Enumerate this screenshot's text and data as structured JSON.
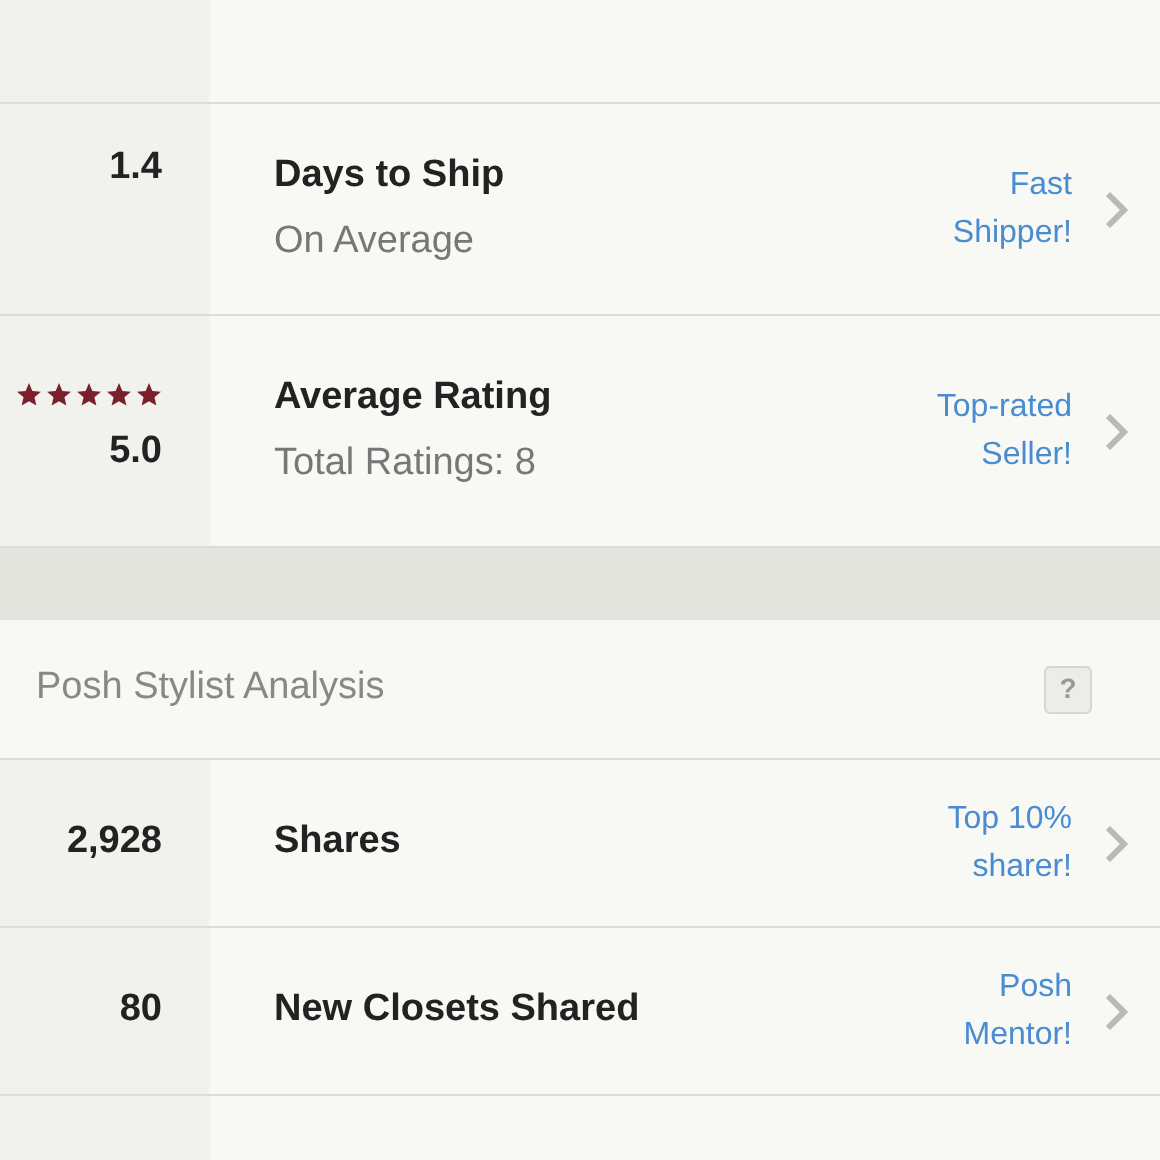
{
  "seller_stats": [
    {
      "kind": "value",
      "value": "1.4",
      "title": "Days to Ship",
      "subtitle": "On Average",
      "badge": "Fast Shipper!"
    },
    {
      "kind": "rating",
      "stars": 5,
      "value": "5.0",
      "title": "Average Rating",
      "subtitle": "Total Ratings: 8",
      "badge": "Top-rated Seller!"
    }
  ],
  "stylist_analysis": {
    "title": "Posh Stylist Analysis",
    "help": "?",
    "rows": [
      {
        "value": "2,928",
        "title": "Shares",
        "badge": "Top 10% sharer!"
      },
      {
        "value": "80",
        "title": "New Closets Shared",
        "badge": "Posh Mentor!"
      }
    ]
  }
}
